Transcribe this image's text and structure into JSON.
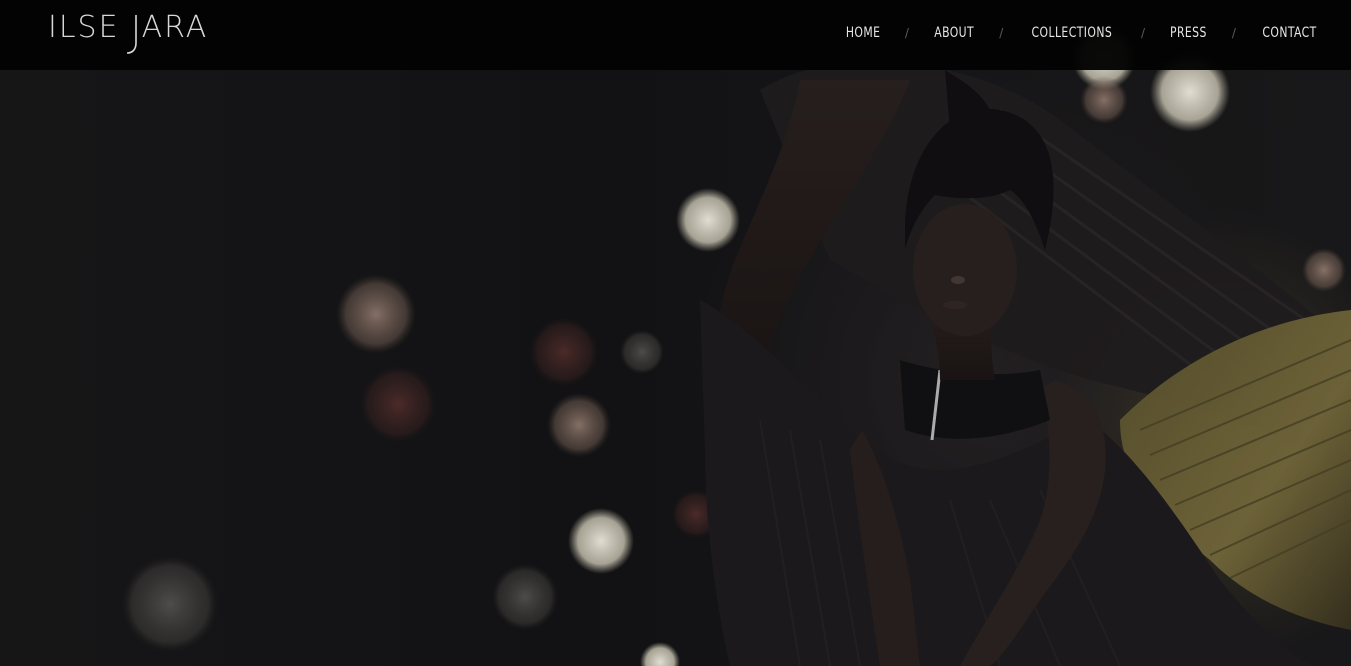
{
  "site": {
    "logo_left": "ILSE",
    "logo_right": "ARA",
    "logo_mark": "J"
  },
  "nav": {
    "items": [
      {
        "label": "HOME"
      },
      {
        "label": "ABOUT"
      },
      {
        "label": "COLLECTIONS"
      },
      {
        "label": "PRESS"
      },
      {
        "label": "CONTACT"
      }
    ],
    "separator": "/"
  },
  "colors": {
    "topbar": "#030303",
    "nav_text": "#e6e6e6",
    "separator": "#5a5a5a",
    "background": "#141416"
  }
}
